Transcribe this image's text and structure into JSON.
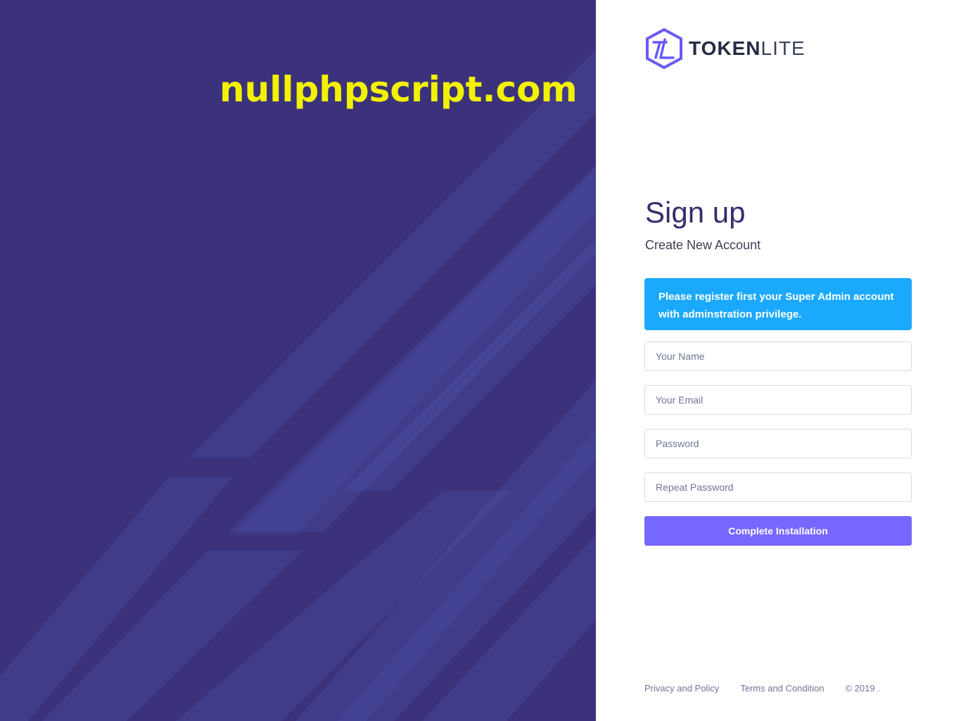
{
  "watermark": "nullphpscript.com",
  "brand": {
    "name_bold": "TOKEN",
    "name_light": "LITE",
    "logo_icon": "tokenlite-hexagon-icon",
    "accent_color": "#6a5af9"
  },
  "signup": {
    "title": "Sign up",
    "subtitle": "Create New Account",
    "alert": "Please register first your Super Admin account with adminstration privilege.",
    "fields": {
      "name_placeholder": "Your Name",
      "email_placeholder": "Your Email",
      "password_placeholder": "Password",
      "repeat_password_placeholder": "Repeat Password"
    },
    "submit_label": "Complete Installation"
  },
  "footer": {
    "privacy": "Privacy and Policy",
    "terms": "Terms and Condition",
    "copyright": "© 2019 ."
  },
  "colors": {
    "left_panel_bg": "#3c327b",
    "alert_bg": "#1ba9fd",
    "button_bg": "#7668fe",
    "watermark": "#f2f200"
  }
}
